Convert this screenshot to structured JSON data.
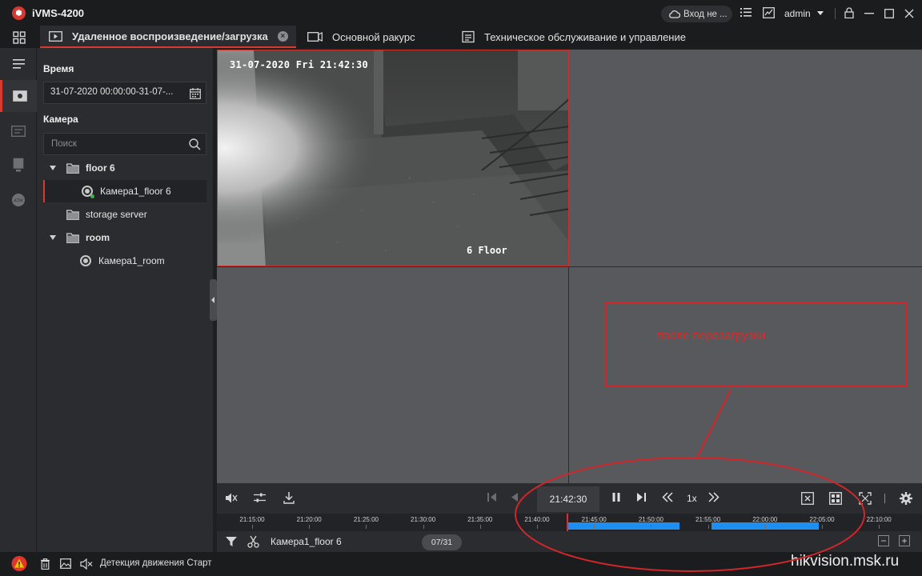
{
  "app": {
    "title": "iVMS-4200"
  },
  "header": {
    "cloud_login": "Вход не ...",
    "user": "admin"
  },
  "tabs": [
    {
      "label": "Удаленное воспроизведение/загрузка",
      "active": true
    },
    {
      "label": "Основной ракурс",
      "active": false
    },
    {
      "label": "Техническое обслуживание и управление",
      "active": false
    }
  ],
  "left_panel": {
    "time_label": "Время",
    "time_range": "31-07-2020 00:00:00-31-07-...",
    "camera_label": "Камера",
    "search_placeholder": "Поиск",
    "tree": [
      {
        "label": "floor 6",
        "type": "folder",
        "expanded": true
      },
      {
        "label": "Камера1_floor 6",
        "type": "camera",
        "selected": true
      },
      {
        "label": "storage server",
        "type": "folder",
        "expanded": false
      },
      {
        "label": "room",
        "type": "folder",
        "expanded": true
      },
      {
        "label": "Камера1_room",
        "type": "camera",
        "selected": false
      }
    ]
  },
  "video": {
    "osd_timestamp": "31-07-2020 Fri 21:42:30",
    "osd_label": "6 Floor"
  },
  "annotation": {
    "text": "после перезагрузки"
  },
  "playback": {
    "current_time": "21:42:30",
    "speed": "1x",
    "timeline_ticks": [
      "21:15:00",
      "21:20:00",
      "21:25:00",
      "21:30:00",
      "21:35:00",
      "21:40:00",
      "21:45:00",
      "21:50:00",
      "21:55:00",
      "22:00:00",
      "22:05:00",
      "22:10:00"
    ],
    "camera_name": "Камера1_floor 6",
    "date": "07/31"
  },
  "status": {
    "text": "Детекция движения Старт"
  },
  "watermark": "hikvision.msk.ru",
  "colors": {
    "accent": "#d83a30",
    "recording": "#1f8ef1",
    "annotation": "#e02828"
  }
}
